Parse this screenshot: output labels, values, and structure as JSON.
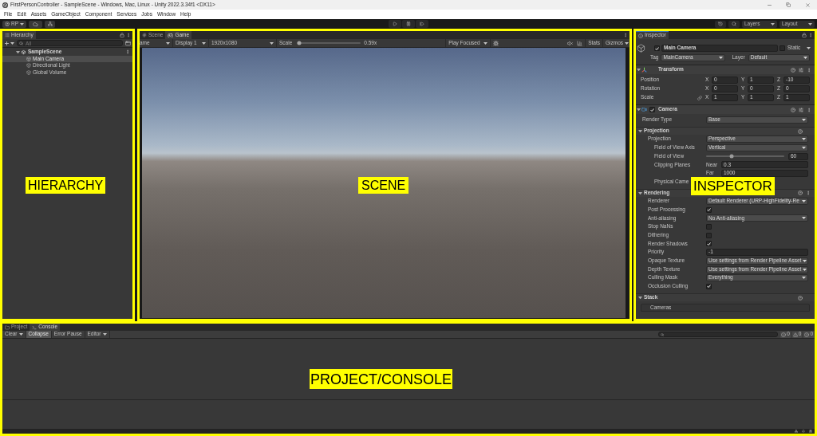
{
  "window": {
    "title": "FirstPersonController - SampleScene - Windows, Mac, Linux - Unity 2022.3.34f1 <DX11>"
  },
  "menu": [
    "File",
    "Edit",
    "Assets",
    "GameObject",
    "Component",
    "Services",
    "Jobs",
    "Window",
    "Help"
  ],
  "toolbar": {
    "account": "RP",
    "layers": "Layers",
    "layout": "Layout"
  },
  "hierarchy": {
    "annotation": "HIERARCHY",
    "tab": "Hierarchy",
    "search": {
      "placeholder": "All"
    },
    "tree": [
      {
        "label": "SampleScene",
        "selected": false,
        "expanded": true,
        "children": [
          {
            "label": "Main Camera",
            "selected": true
          },
          {
            "label": "Directional Light",
            "selected": false
          },
          {
            "label": "Global Volume",
            "selected": false
          }
        ]
      }
    ]
  },
  "game": {
    "annotation": "SCENE",
    "tabs": [
      {
        "kind": "scene",
        "label": "Scene",
        "selected": false
      },
      {
        "kind": "game",
        "label": "Game",
        "selected": true
      }
    ],
    "view_mode": "ame",
    "display": "Display 1",
    "resolution": "1920x1080",
    "scale": {
      "label": "Scale",
      "level": 0.03,
      "reading": "0.59x"
    },
    "play_mode": "Play Focused",
    "stats": "Stats",
    "gizmos": "Gizmos"
  },
  "inspector": {
    "annotation": "INSPECTOR",
    "tab": "Inspector",
    "object": {
      "active": true,
      "name": "Main Camera",
      "static": false,
      "static_label": "Static",
      "tag_label": "Tag",
      "tag": "MainCamera",
      "layer_label": "Layer",
      "layer": "Default"
    },
    "transform": {
      "title": "Transform",
      "expanded": true,
      "rows": [
        {
          "label": "Position",
          "proportions_link": false,
          "fields": [
            {
              "axis": "X",
              "value": "0"
            },
            {
              "axis": "Y",
              "value": "1"
            },
            {
              "axis": "Z",
              "value": "-10"
            }
          ]
        },
        {
          "label": "Rotation",
          "proportions_link": false,
          "fields": [
            {
              "axis": "X",
              "value": "0"
            },
            {
              "axis": "Y",
              "value": "0"
            },
            {
              "axis": "Z",
              "value": "0"
            }
          ]
        },
        {
          "label": "Scale",
          "proportions_link": true,
          "fields": [
            {
              "axis": "X",
              "value": "1"
            },
            {
              "axis": "Y",
              "value": "1"
            },
            {
              "axis": "Z",
              "value": "1"
            }
          ]
        }
      ]
    },
    "camera": {
      "title": "Camera",
      "expanded": true,
      "enabled": true,
      "rows": [
        {
          "kind": "dropdown",
          "label": "Render Type",
          "value": "Base"
        }
      ],
      "sections": [
        {
          "title": "Projection",
          "expanded": true,
          "menu": false,
          "rows": [
            {
              "kind": "dropdown",
              "label": "Projection",
              "value": "Perspective",
              "children": [
                {
                  "kind": "dropdown",
                  "label": "Field of View Axis",
                  "value": "Vertical"
                },
                {
                  "kind": "slider",
                  "label": "Field of View",
                  "level": 0.33,
                  "value": "60"
                },
                {
                  "kind": "range",
                  "label": "Clipping Planes",
                  "fields": [
                    {
                      "label": "Near",
                      "value": "0.3"
                    },
                    {
                      "label": "Far",
                      "value": "1000"
                    }
                  ]
                },
                {
                  "kind": "label",
                  "label": "Physical Came"
                }
              ]
            }
          ]
        },
        {
          "title": "Rendering",
          "expanded": true,
          "menu": true,
          "rows": [
            {
              "kind": "dropdown",
              "label": "Renderer",
              "value": "Default Renderer (URP-HighFidelity-Re"
            },
            {
              "kind": "checkbox",
              "label": "Post Processing",
              "checked": true
            },
            {
              "kind": "dropdown",
              "label": "Anti-aliasing",
              "value": "No Anti-aliasing"
            },
            {
              "kind": "checkbox",
              "label": "Stop NaNs",
              "checked": false
            },
            {
              "kind": "checkbox",
              "label": "Dithering",
              "checked": false
            },
            {
              "kind": "checkbox",
              "label": "Render Shadows",
              "checked": true
            },
            {
              "kind": "field",
              "label": "Priority",
              "value": "-1"
            },
            {
              "kind": "dropdown",
              "label": "Opaque Texture",
              "value": "Use settings from Render Pipeline Asset"
            },
            {
              "kind": "dropdown",
              "label": "Depth Texture",
              "value": "Use settings from Render Pipeline Asset"
            },
            {
              "kind": "dropdown",
              "label": "Culling Mask",
              "value": "Everything"
            },
            {
              "kind": "checkbox",
              "label": "Occlusion Culling",
              "checked": true
            }
          ]
        },
        {
          "title": "Stack",
          "expanded": true,
          "menu": false,
          "rows": [
            {
              "kind": "list",
              "label": "Cameras"
            }
          ]
        }
      ]
    }
  },
  "console": {
    "annotation": "PROJECT/CONSOLE",
    "tabs": [
      {
        "kind": "project",
        "label": "Project",
        "selected": false
      },
      {
        "kind": "console",
        "label": "Console",
        "selected": true
      }
    ],
    "buttons": [
      {
        "label": "Clear",
        "dropdown": true,
        "selected": false
      },
      {
        "label": "Collapse",
        "dropdown": false,
        "selected": true
      },
      {
        "label": "Error Pause",
        "dropdown": false,
        "selected": false
      },
      {
        "label": "Editor",
        "dropdown": true,
        "selected": false
      }
    ],
    "counts": [
      {
        "kind": "info",
        "value": "0"
      },
      {
        "kind": "warning",
        "value": "0"
      },
      {
        "kind": "error",
        "value": "0"
      }
    ]
  }
}
